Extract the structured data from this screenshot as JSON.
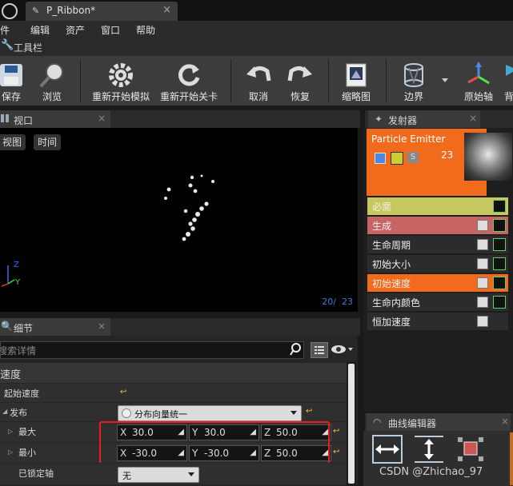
{
  "document_tab": {
    "title": "P_Ribbon*",
    "close": "×"
  },
  "menubar": [
    "文件",
    "编辑",
    "资产",
    "窗口",
    "帮助"
  ],
  "toolbar_panel": {
    "title": "工具栏"
  },
  "toolbar": {
    "save": "保存",
    "browse": "浏览",
    "restart_sim": "重新开始模拟",
    "restart_level": "重新开始关卡",
    "undo": "取消",
    "redo": "恢复",
    "thumbnail": "缩略图",
    "bounds": "边界",
    "origin_axis": "原始轴",
    "background": "背"
  },
  "viewport": {
    "title": "视口",
    "view_btn": "视图",
    "time_btn": "时间",
    "counter": "20/  23",
    "axis_z": "Z",
    "axis_y": "Y"
  },
  "details": {
    "title": "细节",
    "search_placeholder": "搜索详情",
    "category": "速度",
    "rows": {
      "start_velocity": "起始速度",
      "distribution": "发布",
      "distribution_value": "分布向量统一",
      "max": "最大",
      "min": "最小",
      "locked_axes": "已锁定轴",
      "locked_axes_value": "无"
    },
    "max": {
      "x": "30.0",
      "y": "30.0",
      "z": "50.0"
    },
    "min": {
      "x": "-30.0",
      "y": "-30.0",
      "z": "50.0"
    }
  },
  "emitters": {
    "title": "发射器",
    "emitter_name": "Particle Emitter",
    "emitter_count": "23",
    "solo_label": "S",
    "modules": [
      {
        "name": "必需",
        "color": "#c8c860"
      },
      {
        "name": "生成",
        "color": "#c86464"
      },
      {
        "name": "生命周期",
        "color": "#2c2c2c"
      },
      {
        "name": "初始大小",
        "color": "#2c2c2c"
      },
      {
        "name": "初始速度",
        "color": "#f26b1d"
      },
      {
        "name": "生命内颜色",
        "color": "#2c2c2c"
      },
      {
        "name": "恒加速度",
        "color": "#2c2c2c"
      }
    ]
  },
  "curve_editor": {
    "title": "曲线编辑器",
    "watermark": "CSDN @Zhichao_97"
  }
}
